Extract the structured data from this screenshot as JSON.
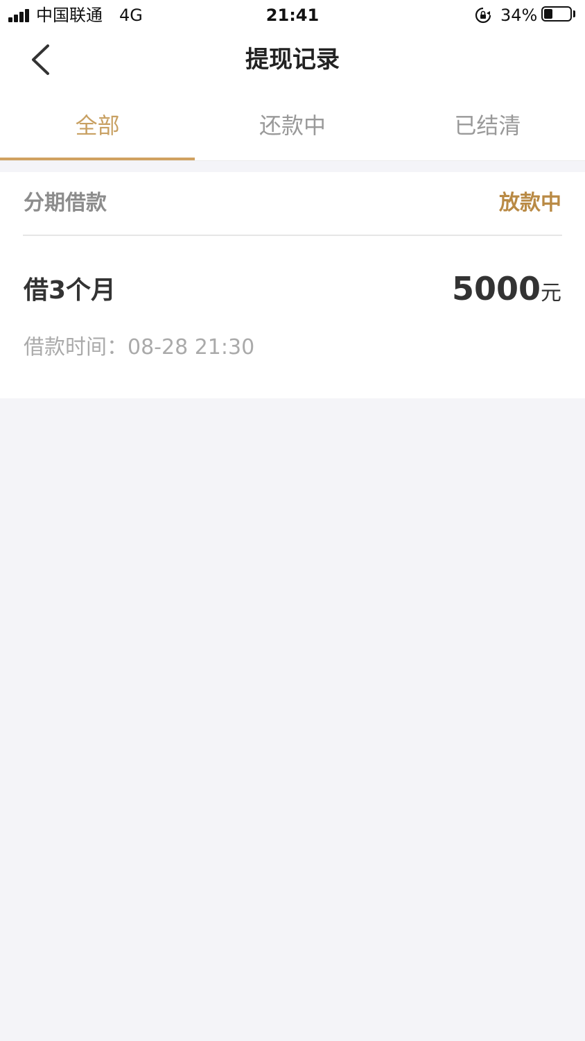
{
  "status_bar": {
    "carrier": "中国联通",
    "network": "4G",
    "time": "21:41",
    "battery_text": "34%",
    "battery_level": 0.34,
    "icons": [
      "signal-icon",
      "rotation-lock-icon",
      "battery-icon"
    ]
  },
  "nav": {
    "back_icon": "chevron-left-icon",
    "title": "提现记录"
  },
  "tabs": [
    {
      "label": "全部",
      "active": true
    },
    {
      "label": "还款中",
      "active": false
    },
    {
      "label": "已结清",
      "active": false
    }
  ],
  "record": {
    "type": "分期借款",
    "status": "放款中",
    "term": "借3个月",
    "amount": "5000",
    "unit": "元",
    "time": "借款时间：08-28 21:30"
  },
  "colors": {
    "accent": "#c8a062",
    "status": "#b98a45",
    "page_bg": "#f4f4f8",
    "card_bg": "#ffffff"
  }
}
